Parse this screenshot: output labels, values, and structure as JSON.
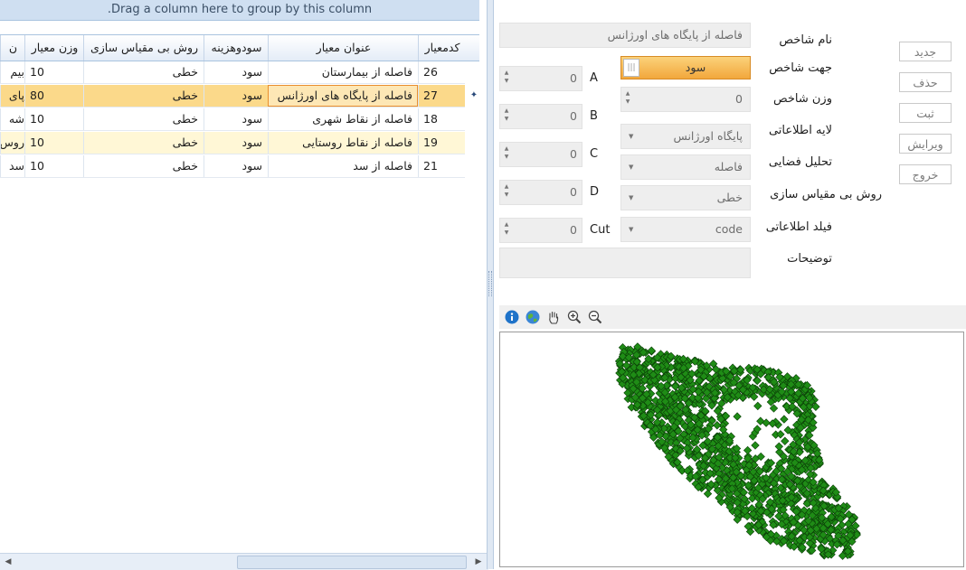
{
  "grid": {
    "group_panel_text": ".Drag a column here to group by this column",
    "columns": [
      "کدمعیار",
      "عنوان معیار",
      "سودوهزینه",
      "روش بی مقیاس سازی",
      "وزن معیار",
      "ن"
    ],
    "rows": [
      {
        "code": "26",
        "title": "فاصله از بیمارستان",
        "benefit": "سود",
        "method": "خطی",
        "weight": "10",
        "extra": "بیم"
      },
      {
        "code": "27",
        "title": "فاصله از پایگاه های اورژانس",
        "benefit": "سود",
        "method": "خطی",
        "weight": "80",
        "extra": "پای"
      },
      {
        "code": "18",
        "title": "فاصله از نقاط شهری",
        "benefit": "سود",
        "method": "خطی",
        "weight": "10",
        "extra": "شه"
      },
      {
        "code": "19",
        "title": "فاصله از نقاط روستایی",
        "benefit": "سود",
        "method": "خطی",
        "weight": "10",
        "extra": "روس"
      },
      {
        "code": "21",
        "title": "فاصله از سد",
        "benefit": "سود",
        "method": "خطی",
        "weight": "10",
        "extra": "سد"
      }
    ],
    "selected_row_index": 1,
    "row_indicator": "✦"
  },
  "form": {
    "labels": {
      "name": "نام شاخص",
      "direction": "جهت شاخص",
      "weight": "وزن شاخص",
      "layer": "لایه اطلاعاتی",
      "analysis": "تحلیل فضایی",
      "method": "روش بی مقیاس سازی",
      "field": "فیلد اطلاعاتی",
      "description": "توضیحات"
    },
    "values": {
      "name": "فاصله از پایگاه های اورژانس",
      "direction": "سود",
      "weight": "0",
      "layer": "پایگاه اورژانس",
      "analysis": "فاصله",
      "method": "خطی",
      "field": "code",
      "description": ""
    },
    "params": [
      {
        "label": "A",
        "value": "0"
      },
      {
        "label": "B",
        "value": "0"
      },
      {
        "label": "C",
        "value": "0"
      },
      {
        "label": "D",
        "value": "0"
      },
      {
        "label": "Cut",
        "value": "0"
      }
    ]
  },
  "buttons": {
    "new": "جدید",
    "delete": "حذف",
    "save": "ثبت",
    "edit": "ویرایش",
    "exit": "خروج"
  },
  "map_tools": [
    "info-icon",
    "globe-icon",
    "pan-hand-icon",
    "zoom-in-icon",
    "zoom-out-icon"
  ],
  "colors": {
    "accent_orange": "#f7b64d",
    "selected_row": "#fbd98a",
    "alt_row": "#fff7d6",
    "header_blue": "#cfdff1",
    "map_points": "#1f8c16"
  }
}
